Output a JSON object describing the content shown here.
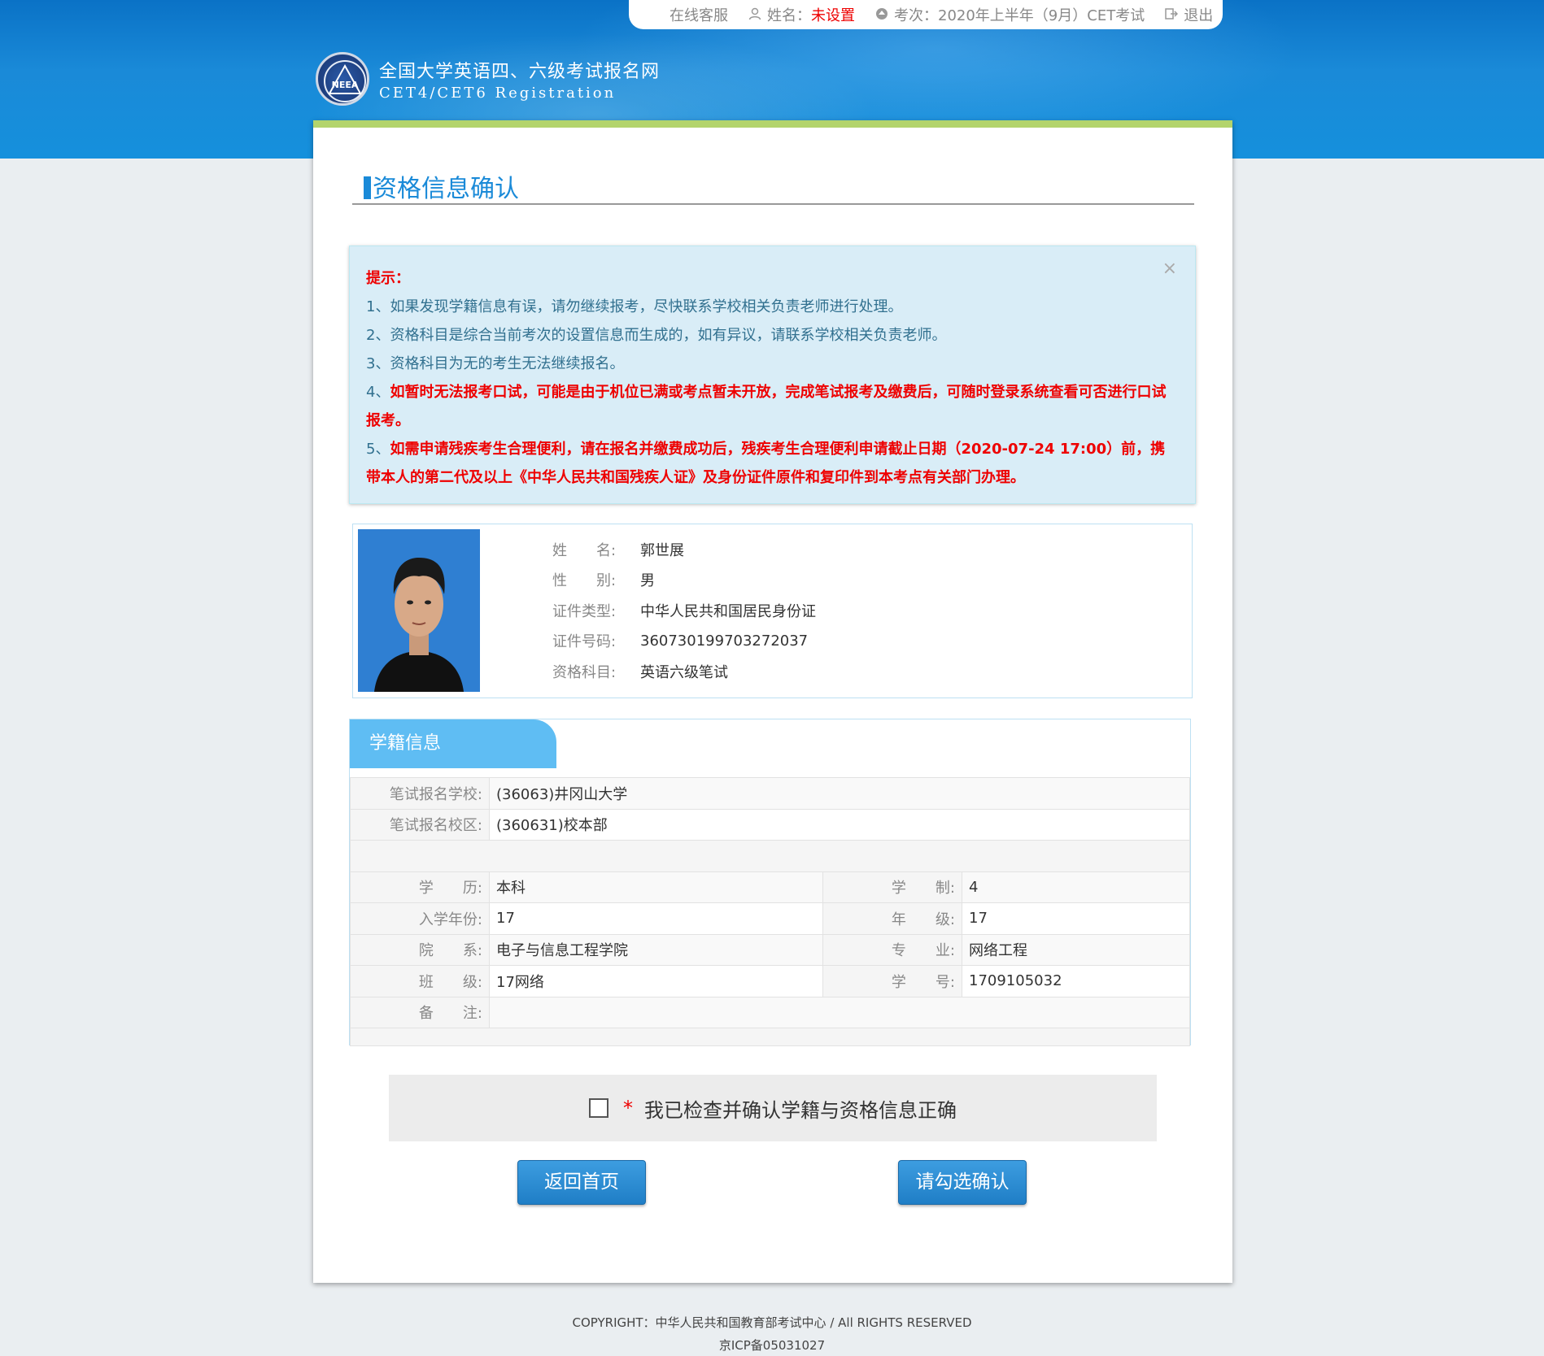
{
  "topbar": {
    "service": "在线客服",
    "name_label": "姓名：",
    "name_value": "未设置",
    "exam_label": "考次：",
    "exam_value": "2020年上半年（9月）CET考试",
    "logout": "退出"
  },
  "logo": {
    "cn": "全国大学英语四、六级考试报名网",
    "en": "CET4/CET6  Registration",
    "emblem_text": "NEEA"
  },
  "page": {
    "title": "资格信息确认"
  },
  "alert": {
    "heading": "提示：",
    "items": [
      "1、如果发现学籍信息有误，请勿继续报考，尽快联系学校相关负责老师进行处理。",
      "2、资格科目是综合当前考次的设置信息而生成的，如有异议，请联系学校相关负责老师。",
      "3、资格科目为无的考生无法继续报名。"
    ],
    "item4_prefix": "4、",
    "item4": "如暂时无法报考口试，可能是由于机位已满或考点暂未开放，完成笔试报考及缴费后，可随时登录系统查看可否进行口试报考。",
    "item5_prefix": "5、",
    "item5": "如需申请残疾考生合理便利，请在报名并缴费成功后，残疾考生合理便利申请截止日期（2020-07-24 17:00）前，携带本人的第二代及以上《中华人民共和国残疾人证》及身份证件原件和复印件到本考点有关部门办理。",
    "close": "×"
  },
  "profile": {
    "rows": [
      {
        "label": "姓　　名:",
        "value": "郭世展"
      },
      {
        "label": "性　　别:",
        "value": "男"
      },
      {
        "label": "证件类型:",
        "value": "中华人民共和国居民身份证"
      },
      {
        "label": "证件号码:",
        "value": "360730199703272037"
      },
      {
        "label": "资格科目:",
        "value": "英语六级笔试"
      }
    ]
  },
  "xueji": {
    "tab": "学籍信息",
    "school_label": "笔试报名学校:",
    "school_value": "(36063)井冈山大学",
    "campus_label": "笔试报名校区:",
    "campus_value": "(360631)校本部",
    "grid": [
      {
        "l1": "学　　历:",
        "v1": "本科",
        "l2": "学　　制:",
        "v2": "4"
      },
      {
        "l1": "入学年份:",
        "v1": "17",
        "l2": "年　　级:",
        "v2": "17"
      },
      {
        "l1": "院　　系:",
        "v1": "电子与信息工程学院",
        "l2": "专　　业:",
        "v2": "网络工程"
      },
      {
        "l1": "班　　级:",
        "v1": "17网络",
        "l2": "学　　号:",
        "v2": "1709105032"
      }
    ],
    "remark_label": "备　　注:",
    "remark_value": ""
  },
  "confirm": {
    "star": "*",
    "text": "我已检查并确认学籍与资格信息正确"
  },
  "buttons": {
    "back": "返回首页",
    "confirm": "请勾选确认"
  },
  "footer": {
    "copyright": "COPYRIGHT：中华人民共和国教育部考试中心 / All RIGHTS RESERVED",
    "icp": "京ICP备05031027"
  },
  "colors": {
    "accent": "#1a8ad8",
    "warning": "#e00000",
    "green_bar": "#b3d46c"
  }
}
